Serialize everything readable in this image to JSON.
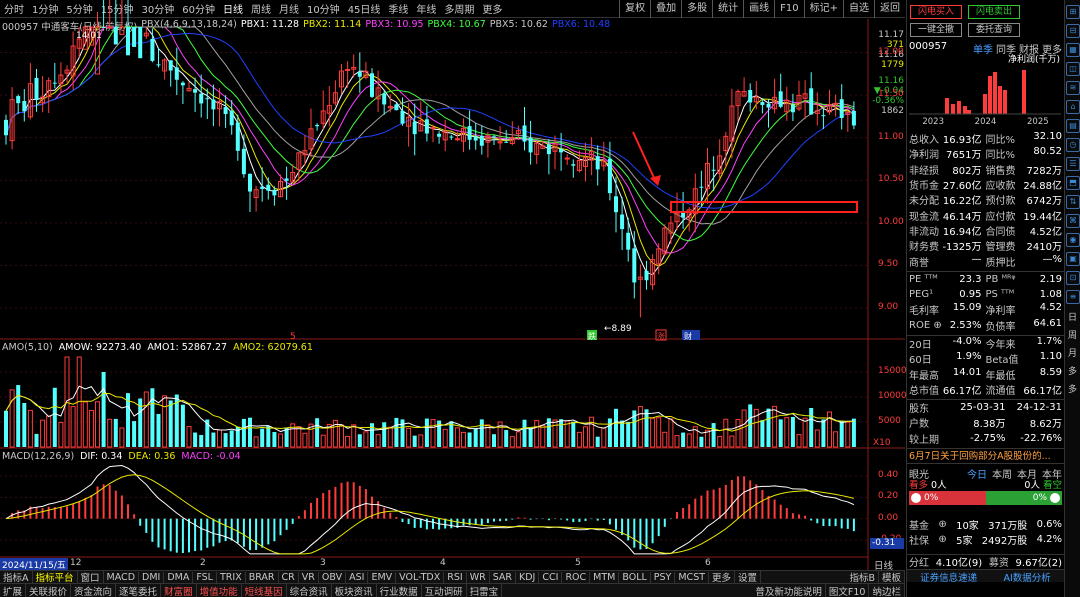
{
  "periods": [
    "分时",
    "1分钟",
    "5分钟",
    "15分钟",
    "30分钟",
    "60分钟",
    "日线",
    "周线",
    "月线",
    "10分钟",
    "45日线",
    "季线",
    "年线",
    "多周期",
    "更多"
  ],
  "active_period": "日线",
  "tools": [
    "复权",
    "叠加",
    "多股",
    "统计",
    "画线",
    "F10",
    "标记+",
    "自选",
    "返回"
  ],
  "main_legend": {
    "code": "000957 中通客车(日线,前复权)",
    "pbx": "PBX(4,6,9,13,18,24)",
    "pbx1": "PBX1: 11.28",
    "pbx2": "PBX2: 11.14",
    "pbx3": "PBX3: 10.95",
    "pbx4": "PBX4: 10.67",
    "pbx5": "PBX5: 10.62",
    "pbx6": "PBX6: 10.48"
  },
  "price_axis": [
    "12.00",
    "11.50",
    "11.00",
    "10.50",
    "10.00",
    "9.50",
    "9.00"
  ],
  "mini_axis": {
    "a": "11.17",
    "b": "371",
    "c": "11.16",
    "d": "1779",
    "e": "11.16",
    "f": "▼-0.04",
    "g": "-0.36%",
    "h": "1862"
  },
  "annotations": {
    "high": "14.01",
    "low": "←8.89",
    "m1": "跌",
    "m2": "涨",
    "m3": "财",
    "m4": "5"
  },
  "amo": {
    "title": "AMO(5,10)",
    "amow": "AMOW: 92273.40",
    "amo1": "AMO1: 52867.27",
    "amo2": "AMO2: 62079.61",
    "axis": [
      "15000",
      "10000",
      "5000"
    ],
    "unit": "X10"
  },
  "macd": {
    "title": "MACD(12,26,9)",
    "dif": "DIF: 0.34",
    "dea": "DEA: 0.36",
    "macd": "MACD: -0.04",
    "axis": [
      "0.40",
      "0.20",
      "0.00",
      "-0.20"
    ],
    "last": "-0.31"
  },
  "date_axis": {
    "first": "2024/11/15/五",
    "ticks": [
      "12",
      "2",
      "3",
      "4",
      "5",
      "6"
    ],
    "period": "日线"
  },
  "indicator_tabs": [
    "指标A",
    "指标平台",
    "窗口",
    "MACD",
    "DMI",
    "DMA",
    "FSL",
    "TRIX",
    "BRAR",
    "CR",
    "VR",
    "OBV",
    "ASI",
    "EMV",
    "VOL-TDX",
    "RSI",
    "WR",
    "SAR",
    "KDJ",
    "CCI",
    "ROC",
    "MTM",
    "BOLL",
    "PSY",
    "MCST",
    "更多",
    "设置"
  ],
  "indicator_tabs_right": [
    "指标B",
    "模板"
  ],
  "bottom_tabs": [
    "扩展",
    "关联报价",
    "资金流向",
    "逐笔委托",
    "财富圈",
    "增值功能",
    "短线基因",
    "综合资讯",
    "板块资讯",
    "行业数据",
    "互动调研",
    "扫雷宝"
  ],
  "bottom_right": [
    "普及新功能说明",
    "图文F10",
    "纳边栏"
  ],
  "chart_data": {
    "type": "candlestick",
    "ylim": [
      8.8,
      12.3
    ],
    "marked_low": 8.89,
    "marked_high": 14.01,
    "ma_last": {
      "PBX1": 11.28,
      "PBX2": 11.14,
      "PBX3": 10.95,
      "PBX4": 10.67,
      "PBX5": 10.62,
      "PBX6": 10.48
    }
  },
  "panel": {
    "buy": "闪电买入",
    "sell": "闪电卖出",
    "cancel": "一键全撤",
    "query": "委托查询",
    "code": "000957",
    "tabs": [
      "单季",
      "同季",
      "财报",
      "更多"
    ],
    "profit_title": "净利润(千万)",
    "years": [
      "2023",
      "2024",
      "2025"
    ],
    "fin": [
      [
        "总收入",
        "16.93亿",
        "同比%",
        "32.10"
      ],
      [
        "净利润",
        "7651万",
        "同比%",
        "80.52"
      ],
      [
        "非经损",
        "802万",
        "销售费",
        "7282万"
      ],
      [
        "货币金",
        "27.60亿",
        "应收款",
        "24.88亿"
      ],
      [
        "未分配",
        "16.22亿",
        "预付款",
        "6742万"
      ],
      [
        "现金流",
        "46.14万",
        "应付款",
        "19.44亿"
      ],
      [
        "非流动",
        "16.94亿",
        "合同债",
        "4.52亿"
      ],
      [
        "财务费",
        "-1325万",
        "管理费",
        "2410万"
      ],
      [
        "商誉",
        "—",
        "质押比",
        "—%"
      ]
    ],
    "val": [
      [
        "PE ᵀᵀᴹ",
        "23.3",
        "PB ᴹᴿᵠ",
        "2.19"
      ],
      [
        "PEG¹",
        "0.95",
        "PS ᵀᵀᴹ",
        "1.08"
      ],
      [
        "毛利率",
        "15.09",
        "净利率",
        "4.52"
      ],
      [
        "ROE ⊕",
        "2.53%",
        "负债率",
        "64.61"
      ]
    ],
    "perf": [
      [
        "20日",
        "-4.0%",
        "今年来",
        "1.7%"
      ],
      [
        "60日",
        "1.9%",
        "Beta值",
        "1.10"
      ],
      [
        "年最高",
        "14.01",
        "年最低",
        "8.59"
      ],
      [
        "总市值",
        "66.17亿",
        "流通值",
        "66.17亿"
      ]
    ],
    "holders": [
      [
        "股东",
        "25-03-31",
        "24-12-31"
      ],
      [
        "户数",
        "8.38万",
        "8.62万"
      ],
      [
        "较上期",
        "-2.75%",
        "-22.76%"
      ]
    ],
    "news": "6月7日关于回购部分A股股份的...",
    "sentiment": {
      "title": "眼光",
      "tabs": [
        "今日",
        "本周",
        "本月",
        "本年"
      ],
      "bull": "看多",
      "bull_n": "0人",
      "bear_n": "0人",
      "bear": "看空",
      "left_pct": "0%",
      "right_pct": "0%"
    },
    "funds": [
      [
        "基金",
        "⊕",
        "10家",
        "371万股",
        "0.6%"
      ],
      [
        "社保",
        "⊕",
        "5家",
        "2492万股",
        "4.2%"
      ]
    ],
    "dividend": {
      "a": "分红",
      "b": "4.10亿(9)",
      "c": "募资",
      "d": "9.67亿(2)"
    },
    "footer": [
      "证券信息速递",
      "AI数据分析"
    ]
  },
  "colors": {
    "up": "#ff3c3c",
    "down": "#54ffff",
    "bg": "#000000"
  }
}
